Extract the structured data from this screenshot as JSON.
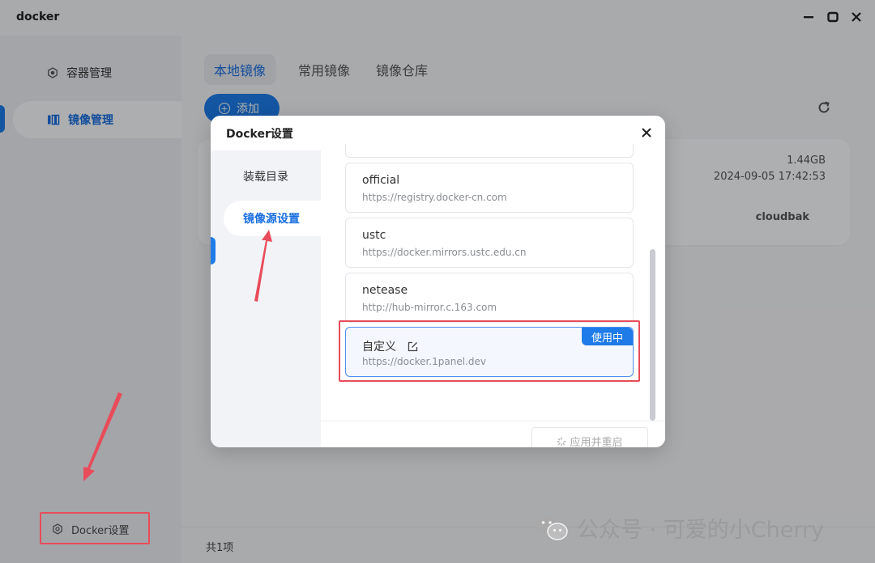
{
  "app": {
    "title": "docker"
  },
  "sidebar": {
    "items": [
      {
        "label": "容器管理",
        "icon": "gear-icon"
      },
      {
        "label": "镜像管理",
        "icon": "book-icon"
      }
    ],
    "bottom": {
      "label": "Docker设置",
      "icon": "settings-icon"
    }
  },
  "main": {
    "tabs": [
      {
        "label": "本地镜像"
      },
      {
        "label": "常用镜像"
      },
      {
        "label": "镜像仓库"
      }
    ],
    "add_label": "添加",
    "card": {
      "size": "1.44GB",
      "date": "2024-09-05 17:42:53",
      "tag": "cloudbak"
    },
    "footer_count": "共1项"
  },
  "dialog": {
    "title": "Docker设置",
    "nav": [
      {
        "label": "装载目录"
      },
      {
        "label": "镜像源设置"
      }
    ],
    "mirrors": [
      {
        "name": "official",
        "url": "https://registry.docker-cn.com"
      },
      {
        "name": "ustc",
        "url": "https://docker.mirrors.ustc.edu.cn"
      },
      {
        "name": "netease",
        "url": "http://hub-mirror.c.163.com"
      },
      {
        "name": "自定义",
        "url": "https://docker.1panel.dev",
        "badge": "使用中"
      }
    ],
    "apply_label": "应用并重启"
  },
  "watermark": "公众号 · 可爱的小Cherry",
  "colors": {
    "accent": "#1e7be8",
    "annotation": "#e84c5a"
  }
}
